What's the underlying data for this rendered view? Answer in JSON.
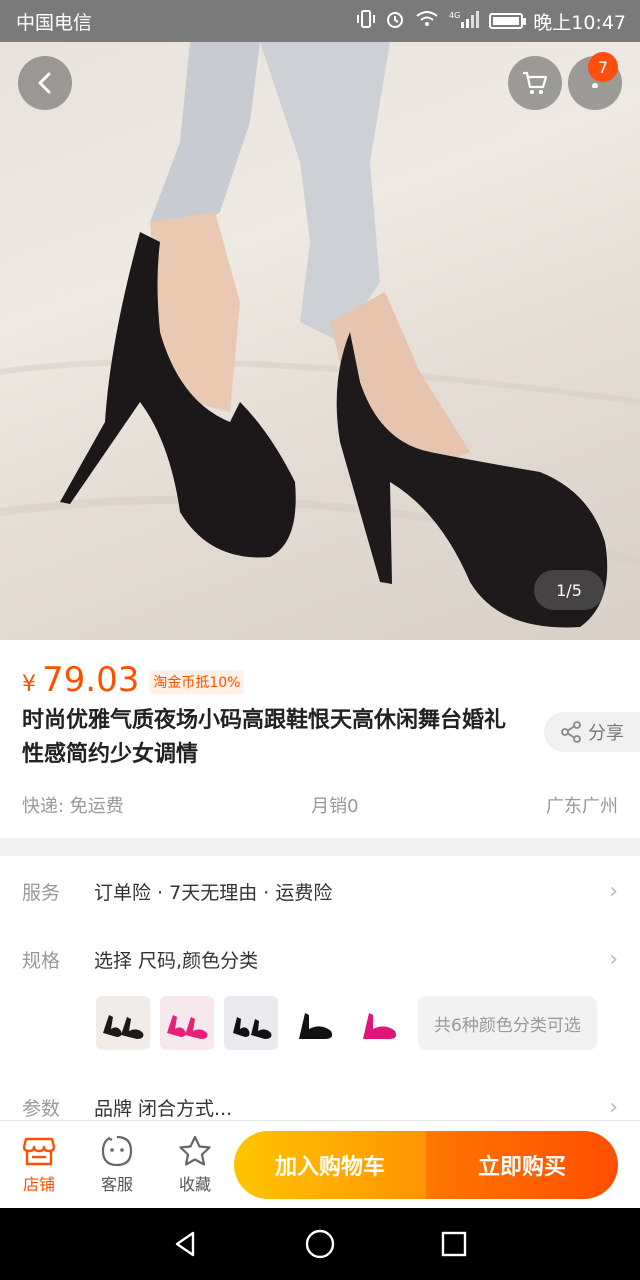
{
  "status_bar": {
    "carrier": "中国电信",
    "time": "晚上10:47",
    "network": "4G"
  },
  "hero": {
    "cart_badge_count": "7",
    "pager": "1/5",
    "background_colors": [
      "#e8e2dc",
      "#d9d1c8"
    ]
  },
  "product": {
    "currency": "¥",
    "price": "79.03",
    "coin_tag": "淘金币抵10%",
    "title": "时尚优雅气质夜场小码高跟鞋恨天高休闲舞台婚礼性感简约少女调情",
    "share_label": "分享",
    "shipping": "快递: 免运费",
    "monthly_sales": "月销0",
    "location": "广东广州"
  },
  "specs": {
    "service_key": "服务",
    "service_value": "订单险 · 7天无理由 · 运费险",
    "spec_key": "规格",
    "spec_value": "选择 尺码,颜色分类",
    "color_thumbs": [
      "black-pair",
      "pink-pair",
      "black-pair-2",
      "black-single",
      "pink-single"
    ],
    "more_colors": "共6种颜色分类可选",
    "param_key": "参数",
    "param_value": "品牌 闭合方式..."
  },
  "action_bar": {
    "store_label": "店铺",
    "service_label": "客服",
    "favorite_label": "收藏",
    "add_to_cart": "加入购物车",
    "buy_now": "立即购买"
  },
  "colors": {
    "accent": "#ff5000",
    "cart_gradient": [
      "#ffc500",
      "#ff9402"
    ],
    "buy_gradient": [
      "#ff7700",
      "#ff4e00"
    ]
  }
}
